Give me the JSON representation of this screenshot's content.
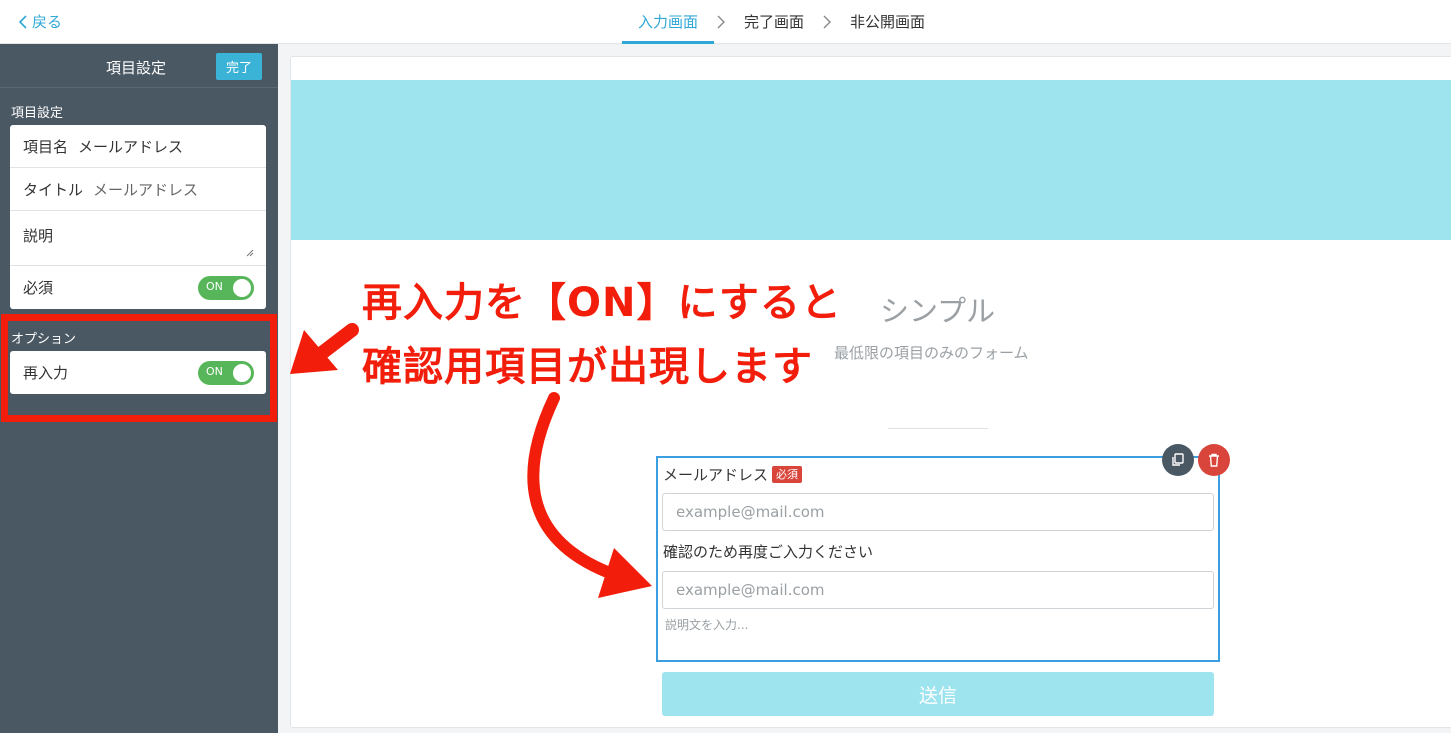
{
  "topbar": {
    "back_label": "戻る",
    "steps": [
      "入力画面",
      "完了画面",
      "非公開画面"
    ],
    "active_step": "入力画面"
  },
  "sidebar": {
    "title": "項目設定",
    "done_label": "完了",
    "section_label": "項目設定",
    "fields": {
      "name_label": "項目名",
      "name_value": "メールアドレス",
      "title_label": "タイトル",
      "title_value": "メールアドレス",
      "description_label": "説明",
      "required_label": "必須",
      "required_toggle": "ON"
    },
    "option_label": "オプション",
    "reentry_label": "再入力",
    "reentry_toggle": "ON"
  },
  "form": {
    "title": "シンプル",
    "subtitle": "最低限の項目のみのフォーム",
    "field_label": "メールアドレス",
    "required_badge": "必須",
    "email_placeholder": "example@mail.com",
    "confirm_label": "確認のため再度ご入力ください",
    "confirm_placeholder": "example@mail.com",
    "description_placeholder": "説明文を入力...",
    "submit_label": "送信"
  },
  "annotation": {
    "line1": "再入力を【ON】にすると",
    "line2": "確認用項目が出現します",
    "color": "#f21d0a"
  },
  "colors": {
    "accent": "#2fa8d6",
    "sidebar_bg": "#4a5863",
    "toggle_on": "#58b65a",
    "banner": "#9de4ee",
    "danger": "#d9443b"
  }
}
